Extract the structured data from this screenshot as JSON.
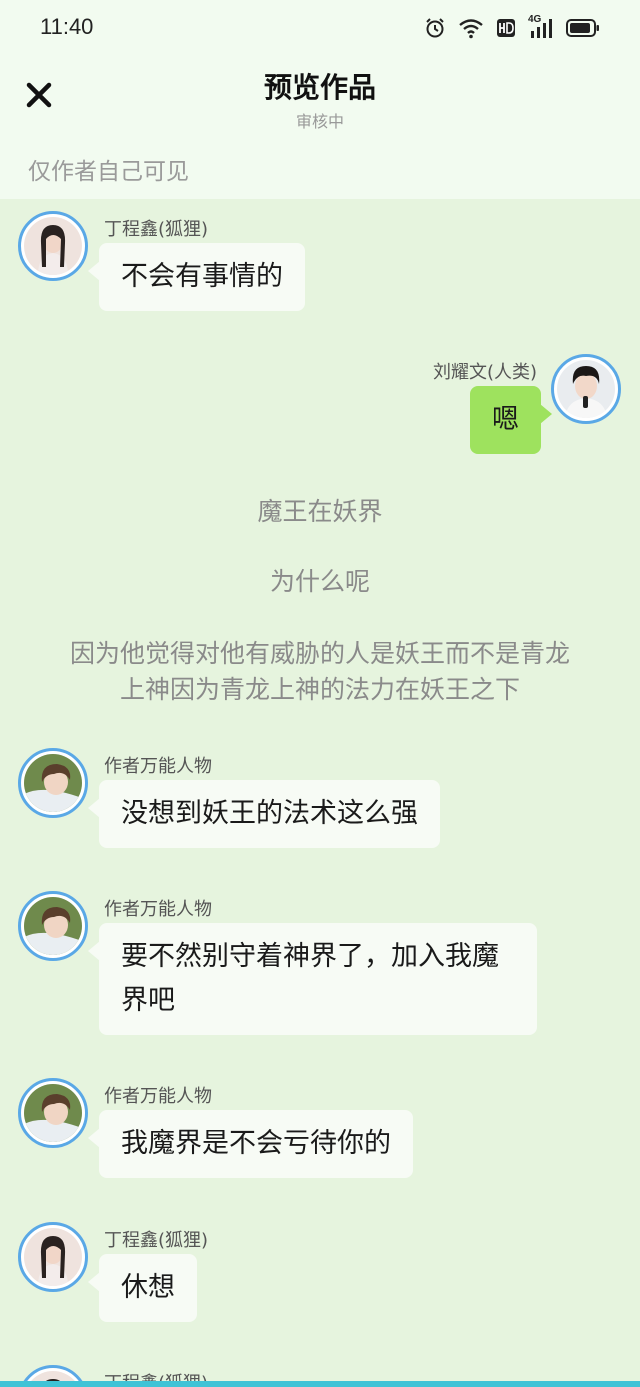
{
  "status_bar": {
    "time": "11:40",
    "network": "4G"
  },
  "header": {
    "title": "预览作品",
    "subtitle": "审核中"
  },
  "visibility_note": "仅作者自己可见",
  "messages": [
    {
      "name": "丁程鑫(狐狸)",
      "text": "不会有事情的"
    },
    {
      "name": "刘耀文(人类)",
      "text": "嗯"
    },
    {
      "narration": "魔王在妖界"
    },
    {
      "narration": "为什么呢"
    },
    {
      "narration": "因为他觉得对他有威胁的人是妖王而不是青龙上神因为青龙上神的法力在妖王之下"
    },
    {
      "name": "作者万能人物",
      "text": "没想到妖王的法术这么强"
    },
    {
      "name": "作者万能人物",
      "text": "要不然别守着神界了，加入我魔界吧"
    },
    {
      "name": "作者万能人物",
      "text": "我魔界是不会亏待你的"
    },
    {
      "name": "丁程鑫(狐狸)",
      "text": "休想"
    },
    {
      "name": "丁程鑫(狐狸)"
    }
  ],
  "colors": {
    "background": "#e6f4de",
    "bubble_right": "#9ee25e",
    "avatar_border": "#5aa8e6"
  }
}
